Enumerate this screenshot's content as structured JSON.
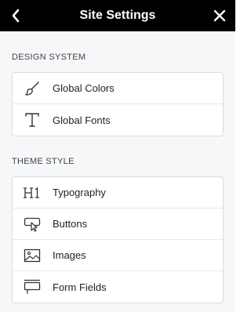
{
  "header": {
    "title": "Site Settings"
  },
  "sections": [
    {
      "label": "DESIGN SYSTEM",
      "items": [
        {
          "label": "Global Colors",
          "icon": "brush-icon"
        },
        {
          "label": "Global Fonts",
          "icon": "font-t-icon"
        }
      ]
    },
    {
      "label": "THEME STYLE",
      "items": [
        {
          "label": "Typography",
          "icon": "heading-h1-icon"
        },
        {
          "label": "Buttons",
          "icon": "button-cursor-icon"
        },
        {
          "label": "Images",
          "icon": "image-icon"
        },
        {
          "label": "Form Fields",
          "icon": "form-fields-icon"
        }
      ]
    }
  ],
  "colors": {
    "header_bg": "#000000",
    "panel_bg": "#f6f7f8",
    "card_border": "#dcdcde"
  }
}
